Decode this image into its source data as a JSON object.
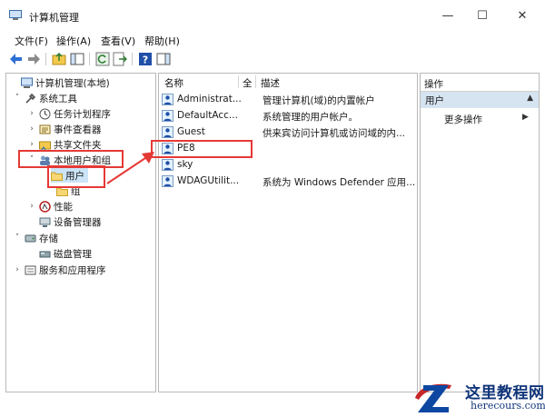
{
  "window": {
    "title": "计算机管理"
  },
  "controls": {
    "minimize": "—",
    "maximize": "☐",
    "close": "✕"
  },
  "menu": [
    "文件(F)",
    "操作(A)",
    "查看(V)",
    "帮助(H)"
  ],
  "tree": [
    {
      "label": "计算机管理(本地)",
      "expander": "",
      "icon": "computer-icon"
    },
    {
      "label": "系统工具",
      "expander": "˅",
      "icon": "tools-icon"
    },
    {
      "label": "任务计划程序",
      "expander": "›",
      "icon": "clock-icon"
    },
    {
      "label": "事件查看器",
      "expander": "›",
      "icon": "event-viewer-icon"
    },
    {
      "label": "共享文件夹",
      "expander": "›",
      "icon": "shared-folder-icon"
    },
    {
      "label": "本地用户和组",
      "expander": "˅",
      "icon": "users-groups-icon"
    },
    {
      "label": "用户",
      "expander": "",
      "icon": "folder-icon"
    },
    {
      "label": "组",
      "expander": "",
      "icon": "folder-icon"
    },
    {
      "label": "性能",
      "expander": "›",
      "icon": "performance-icon"
    },
    {
      "label": "设备管理器",
      "expander": "",
      "icon": "device-manager-icon"
    },
    {
      "label": "存储",
      "expander": "˅",
      "icon": "storage-icon"
    },
    {
      "label": "磁盘管理",
      "expander": "",
      "icon": "disk-icon"
    },
    {
      "label": "服务和应用程序",
      "expander": "›",
      "icon": "services-icon"
    }
  ],
  "list": {
    "headers": {
      "name": "名称",
      "full": "全",
      "desc": "描述"
    },
    "rows": [
      {
        "name": "Administrat...",
        "desc": "管理计算机(域)的内置帐户"
      },
      {
        "name": "DefaultAcc...",
        "desc": "系统管理的用户帐户。"
      },
      {
        "name": "Guest",
        "desc": "供来宾访问计算机或访问域的内..."
      },
      {
        "name": "PE8",
        "desc": ""
      },
      {
        "name": "sky",
        "desc": ""
      },
      {
        "name": "WDAGUtilit...",
        "desc": "系统为 Windows Defender 应用..."
      }
    ]
  },
  "actions": {
    "title": "操作",
    "section": "用户",
    "more": "更多操作"
  },
  "watermark": {
    "title": "这里教程网",
    "url": "herecours.com"
  },
  "colors": {
    "annotation": "#e53935",
    "selection": "#cce4f7",
    "action_header": "#d6e4f2"
  }
}
